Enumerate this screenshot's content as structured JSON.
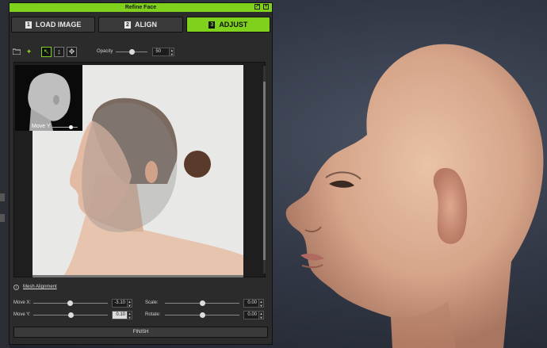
{
  "window": {
    "title": "Refine Face"
  },
  "steps": [
    {
      "num": "1",
      "label": "LOAD IMAGE"
    },
    {
      "num": "2",
      "label": "ALIGN"
    },
    {
      "num": "3",
      "label": "ADJUST"
    }
  ],
  "toolbar": {
    "opacity_label": "Opacity",
    "opacity_value": "50"
  },
  "inset": {
    "label": "Move Y"
  },
  "mesh_alignment": {
    "label": "Mesh Alignment"
  },
  "params": {
    "move_x": {
      "label": "Move X:",
      "value": "-3.10"
    },
    "move_y": {
      "label": "Move Y:",
      "value": "0.10"
    },
    "scale": {
      "label": "Scale:",
      "value": "0.00"
    },
    "rotate": {
      "label": "Rotate:",
      "value": "0.00"
    }
  },
  "finish_label": "FINISH",
  "colors": {
    "accent": "#7fd11b",
    "panel": "#2b2b2b"
  }
}
